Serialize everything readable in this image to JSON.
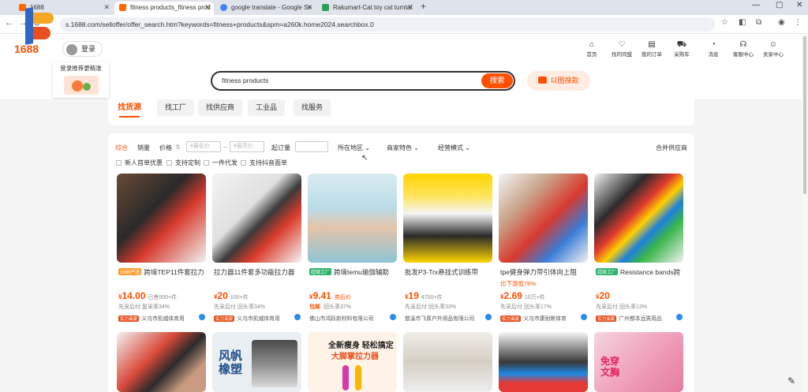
{
  "browser": {
    "tabs": [
      {
        "title": "1688",
        "active": false
      },
      {
        "title": "fitness products_fitness prod",
        "active": true
      },
      {
        "title": "google translate - Google Se",
        "active": false
      },
      {
        "title": "Rakumart-Cat toy cat turntal",
        "active": false
      }
    ],
    "new_tab": "+",
    "url": "s.1688.com/selloffer/offer_search.htm?keywords=fitness+products&spm=a260k.home2024.searchbox.0"
  },
  "site": {
    "logo_text": "1688",
    "login_label": "登录",
    "promo_text": "登录推荐更精准",
    "top_nav": [
      {
        "label": "首页",
        "icon": "home-icon"
      },
      {
        "label": "找的同盟",
        "icon": "heart-icon"
      },
      {
        "label": "我的订单",
        "icon": "order-icon"
      },
      {
        "label": "采购车",
        "icon": "cart-icon"
      },
      {
        "label": "消息",
        "icon": "bell-icon"
      },
      {
        "label": "客服中心",
        "icon": "headset-icon"
      },
      {
        "label": "卖家中心",
        "icon": "seller-icon"
      }
    ]
  },
  "search": {
    "query": "fitness products",
    "button_label": "搜索",
    "image_search_label": "以图搜款"
  },
  "category_tabs": [
    {
      "label": "找货源",
      "active": true
    },
    {
      "label": "找工厂",
      "active": false
    },
    {
      "label": "找供应商",
      "active": false
    },
    {
      "label": "工业品",
      "active": false
    },
    {
      "label": "找服务",
      "active": false
    }
  ],
  "filters": {
    "sort": [
      "综合",
      "销量",
      "价格"
    ],
    "price_min_placeholder": "¥最低价",
    "price_max_placeholder": "¥最高价",
    "price_sep": "–",
    "moq_label": "起订量",
    "dropdowns": [
      "所在地区",
      "商家特色",
      "经营模式"
    ],
    "merge_label": "合并供应商",
    "checkboxes": [
      "新人首单优惠",
      "支持定制",
      "一件代发",
      "支持抖音面单"
    ]
  },
  "products": [
    {
      "badge": "1688严选",
      "badge_color": "#ff9b2f",
      "title": "跨境TEP11件套拉力",
      "sub": "",
      "price": "14.00",
      "sold": "已售500+件",
      "tag": "",
      "pct": "复采率34%",
      "pct_prefix": "先采后付",
      "shop_tag": "实力商家",
      "shop": "义乌市凯威体育用"
    },
    {
      "badge": "",
      "badge_color": "",
      "title": "拉力器11件套多功能拉力器",
      "sub": "",
      "price": "20",
      "sold": "100+件",
      "tag": "",
      "pct": "回头率34%",
      "pct_prefix": "先采后付",
      "shop_tag": "实力商家",
      "shop": "义乌市凯威体育用"
    },
    {
      "badge": "超级工厂",
      "badge_color": "#2db36a",
      "title": "跨境temu瑜伽辅助",
      "sub": "",
      "price": "9.41",
      "sold": "",
      "tag": "券后价",
      "pct": "回头率37%",
      "pct_prefix": "包邮",
      "shop_tag": "",
      "shop": "佛山市鸿跃新材料有限公司"
    },
    {
      "badge": "",
      "badge_color": "",
      "title": "批发P3-Trx悬挂式训练带",
      "sub": "",
      "price": "19",
      "sold": "4700+件",
      "tag": "",
      "pct": "回头率33%",
      "pct_prefix": "先采后付",
      "shop_tag": "",
      "shop": "慈溪市飞厚户外用品有限公司"
    },
    {
      "badge": "",
      "badge_color": "",
      "title": "tpe健身弹力带引体向上阻",
      "sub": "比下游低76%",
      "price": "2.69",
      "sold": "10万+件",
      "tag": "",
      "pct": "回头率17%",
      "pct_prefix": "先采后付",
      "shop_tag": "实力商家",
      "shop": "义乌市康耐斯体育"
    },
    {
      "badge": "超级工厂",
      "badge_color": "#2db36a",
      "title": "Resistance bands跨",
      "sub": "",
      "price": "20",
      "sold": "",
      "tag": "",
      "pct": "回头率13%",
      "pct_prefix": "先采后付",
      "shop_tag": "实力商家",
      "shop": "广州都本远男用品"
    }
  ],
  "row2_texts": [
    "风帆橡塑",
    "全新瘦身 轻松搞定",
    "大脚掌拉力器",
    "免穿文胸"
  ],
  "colors": {
    "accent": "#ff5000",
    "bg": "#f4f4f4"
  }
}
